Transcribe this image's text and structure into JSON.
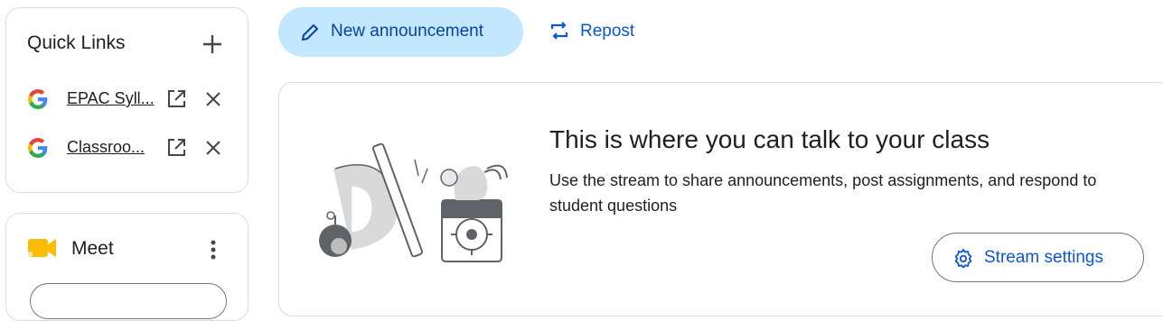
{
  "quick_links": {
    "title": "Quick Links",
    "items": [
      {
        "label": "EPAC Syll...",
        "icon": "google-icon"
      },
      {
        "label": "Classroo...",
        "icon": "google-icon"
      }
    ]
  },
  "meet": {
    "title": "Meet"
  },
  "actions": {
    "new_announcement": "New announcement",
    "repost": "Repost"
  },
  "stream": {
    "title": "This is where you can talk to your class",
    "description": "Use the stream to share announcements, post assignments, and respond to student questions",
    "settings_label": "Stream settings"
  },
  "colors": {
    "primary_blue": "#0b57d0",
    "button_fill": "#c2e7ff",
    "border": "#dadce0"
  }
}
